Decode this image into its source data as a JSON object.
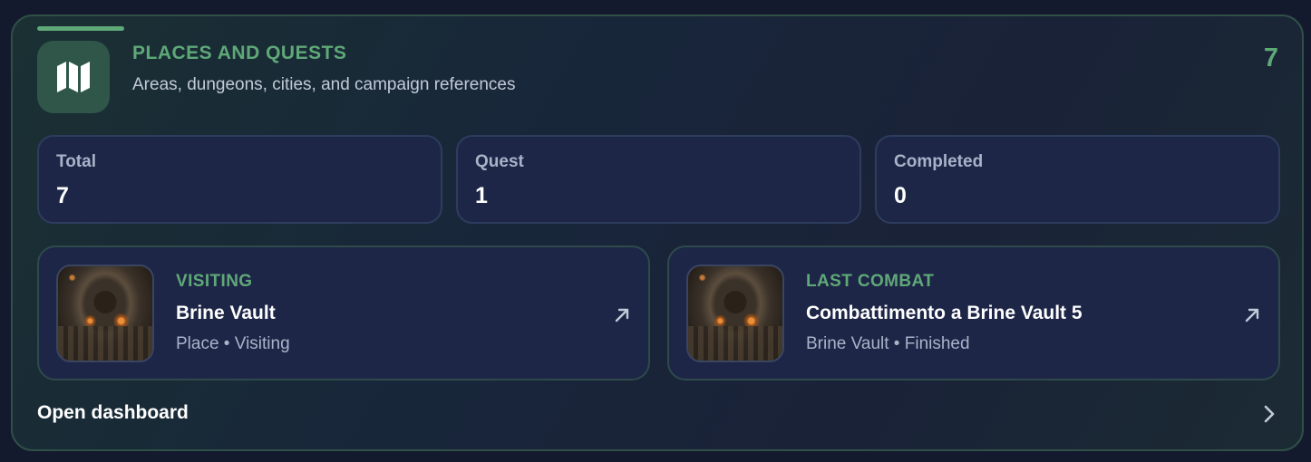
{
  "header": {
    "icon": "map-icon",
    "title": "PLACES AND QUESTS",
    "subtitle": "Areas, dungeons, cities, and campaign references",
    "count": "7"
  },
  "stats": [
    {
      "label": "Total",
      "value": "7"
    },
    {
      "label": "Quest",
      "value": "1"
    },
    {
      "label": "Completed",
      "value": "0"
    }
  ],
  "visiting": {
    "kicker": "VISITING",
    "title": "Brine Vault",
    "meta": "Place • Visiting",
    "thumbnail": "dungeon-image",
    "link_icon": "arrow-up-right-icon"
  },
  "last_combat": {
    "kicker": "LAST COMBAT",
    "title": "Combattimento a Brine Vault 5",
    "meta": "Brine Vault • Finished",
    "thumbnail": "dungeon-image",
    "link_icon": "arrow-up-right-icon"
  },
  "footer": {
    "open_label": "Open dashboard",
    "chevron_icon": "chevron-right-icon"
  },
  "colors": {
    "accent": "#5fa878",
    "card_bg": "#1d2647",
    "page_bg": "#141a2e"
  }
}
